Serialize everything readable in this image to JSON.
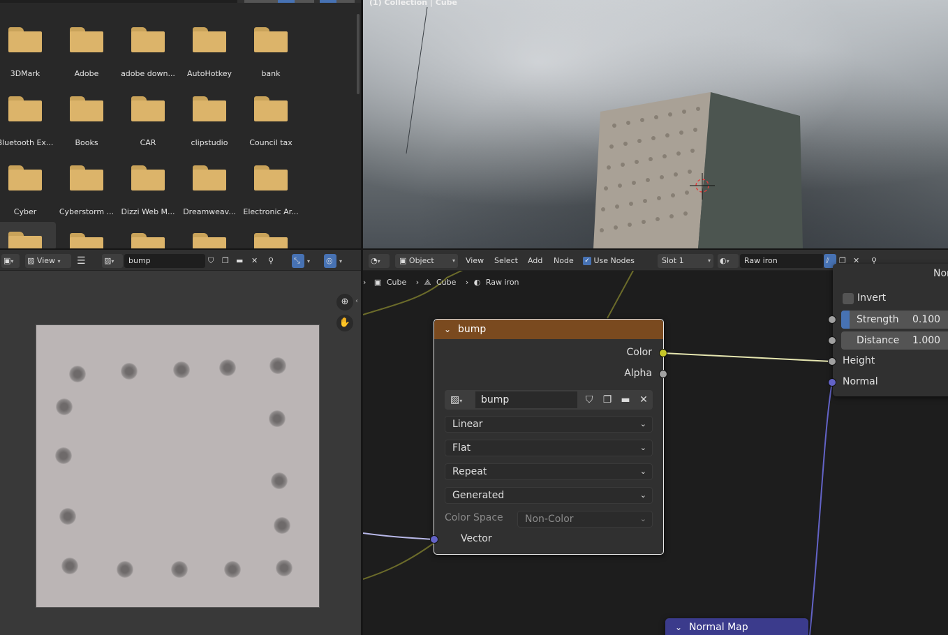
{
  "file_browser": {
    "folders": [
      [
        "3DMark",
        "Adobe",
        "adobe down...",
        "AutoHotkey",
        "bank"
      ],
      [
        "Bluetooth Ex...",
        "Books",
        "CAR",
        "clipstudio",
        "Council tax"
      ],
      [
        "Cyber",
        "Cyberstorm ...",
        "Dizzi Web M...",
        "Dreamweav...",
        "Electronic Ar..."
      ]
    ],
    "folder_color": "#dcb46a"
  },
  "viewport": {
    "label": "(1) Collection | Cube"
  },
  "image_editor": {
    "header": {
      "view_label": "View",
      "image_name": "bump"
    }
  },
  "node_editor": {
    "header": {
      "mode": "Object",
      "menus": [
        "View",
        "Select",
        "Add",
        "Node"
      ],
      "use_nodes_label": "Use Nodes",
      "use_nodes_checked": true,
      "slot": "Slot 1",
      "material": "Raw iron"
    },
    "breadcrumb": [
      "Cube",
      "Cube",
      "Raw iron"
    ],
    "image_node": {
      "title": "bump",
      "header_color": "#7a4a1f",
      "outputs": [
        "Color",
        "Alpha"
      ],
      "image_name": "bump",
      "interpolation": "Linear",
      "projection": "Flat",
      "extension": "Repeat",
      "source": "Generated",
      "color_space_label": "Color Space",
      "color_space": "Non-Color",
      "input": "Vector"
    },
    "bump_node": {
      "title": "Norma",
      "invert_label": "Invert",
      "strength_label": "Strength",
      "strength_value": "0.100",
      "distance_label": "Distance",
      "distance_value": "1.000",
      "height_label": "Height",
      "normal_label": "Normal"
    },
    "normal_map_node": {
      "title": "Normal Map",
      "header_color": "#3b3b8c"
    }
  }
}
